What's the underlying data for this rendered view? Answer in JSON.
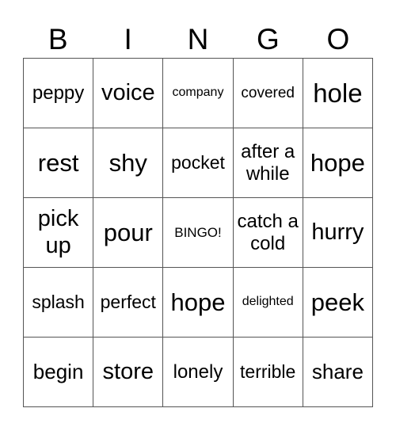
{
  "header": [
    "B",
    "I",
    "N",
    "G",
    "O"
  ],
  "cells": [
    {
      "text": "peppy",
      "size": "s24"
    },
    {
      "text": "voice",
      "size": "s29"
    },
    {
      "text": "company",
      "size": "s16"
    },
    {
      "text": "covered",
      "size": "s19"
    },
    {
      "text": "hole",
      "size": "s33"
    },
    {
      "text": "rest",
      "size": "s31"
    },
    {
      "text": "shy",
      "size": "s31"
    },
    {
      "text": "pocket",
      "size": "s23"
    },
    {
      "text": "after a while",
      "size": "s24"
    },
    {
      "text": "hope",
      "size": "s31"
    },
    {
      "text": "pick up",
      "size": "s29"
    },
    {
      "text": "pour",
      "size": "s31"
    },
    {
      "text": "BINGO!",
      "size": "s17"
    },
    {
      "text": "catch a cold",
      "size": "s24"
    },
    {
      "text": "hurry",
      "size": "s29"
    },
    {
      "text": "splash",
      "size": "s23"
    },
    {
      "text": "perfect",
      "size": "s23"
    },
    {
      "text": "hope",
      "size": "s31"
    },
    {
      "text": "delighted",
      "size": "s16"
    },
    {
      "text": "peek",
      "size": "s31"
    },
    {
      "text": "begin",
      "size": "s26"
    },
    {
      "text": "store",
      "size": "s29"
    },
    {
      "text": "lonely",
      "size": "s24"
    },
    {
      "text": "terrible",
      "size": "s23"
    },
    {
      "text": "share",
      "size": "s26"
    }
  ]
}
